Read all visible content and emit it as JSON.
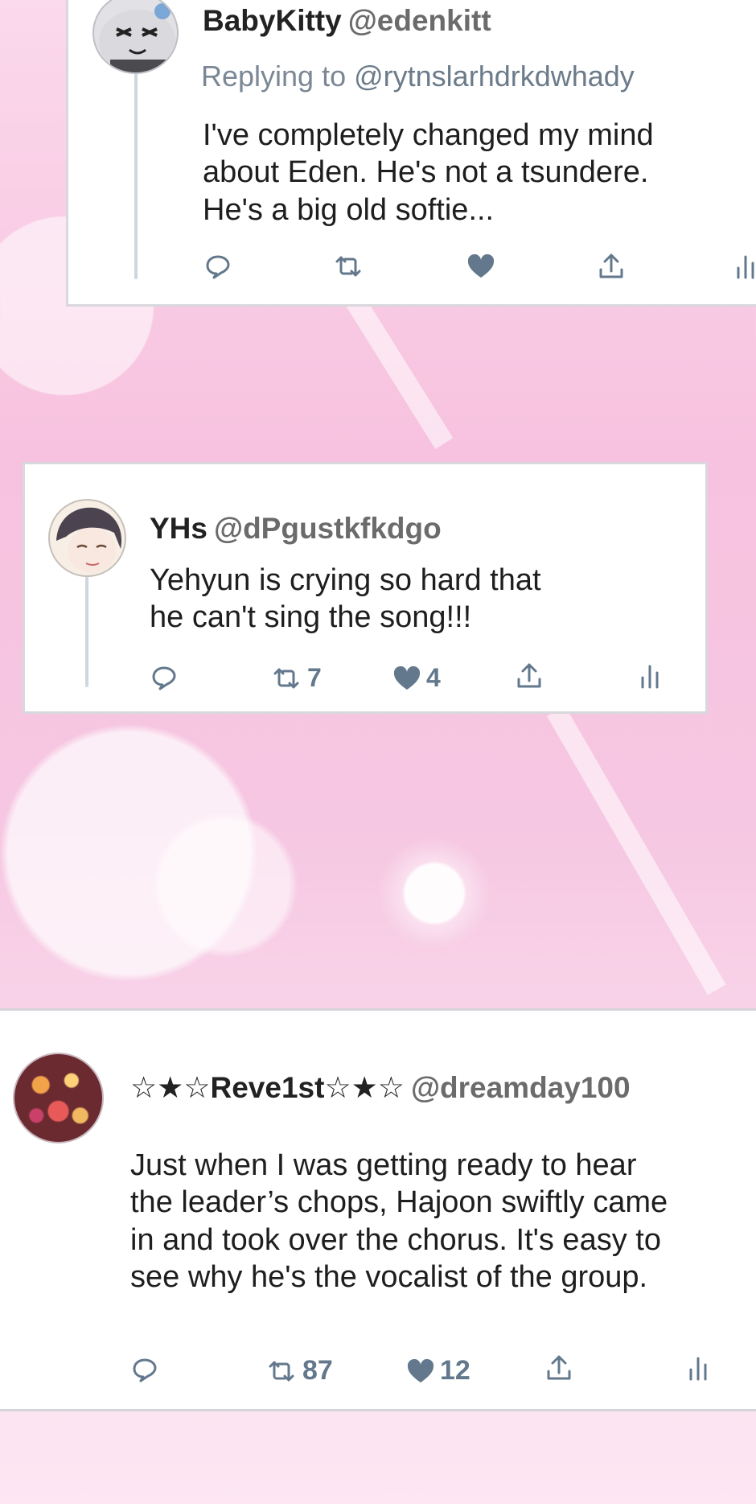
{
  "tweets": [
    {
      "display_name": "BabyKitty",
      "handle": "@edenkitt",
      "replying_prefix": "Replying to",
      "replying_handle": "@rytnslarhdrkdwhady",
      "text": "I've completely changed my mind\nabout Eden. He's not a tsundere.\nHe's a big old softie...",
      "retweets": "",
      "likes": "",
      "liked": true
    },
    {
      "display_name": "YHs",
      "handle": "@dPgustkfkdgo",
      "text": "Yehyun is crying so hard that\nhe can't sing the song!!!",
      "retweets": "7",
      "likes": "4",
      "liked": true
    },
    {
      "display_name": "☆★☆Reve1st☆★☆",
      "handle": "@dreamday100",
      "text": "Just when I was getting ready to hear\nthe leader’s chops, Hajoon swiftly came\nin and took over the chorus. It's easy to\nsee why he's the vocalist of the group.",
      "retweets": "87",
      "likes": "12",
      "liked": true
    }
  ],
  "icons": {
    "reply": "speech-bubble-icon",
    "retweet": "retweet-icon",
    "like": "heart-icon",
    "share": "share-icon",
    "analytics": "bar-chart-icon"
  },
  "colors": {
    "icon": "#63788c",
    "text": "#1e1e1e",
    "handle": "#6b6b6b",
    "background": "#f7c2df"
  }
}
